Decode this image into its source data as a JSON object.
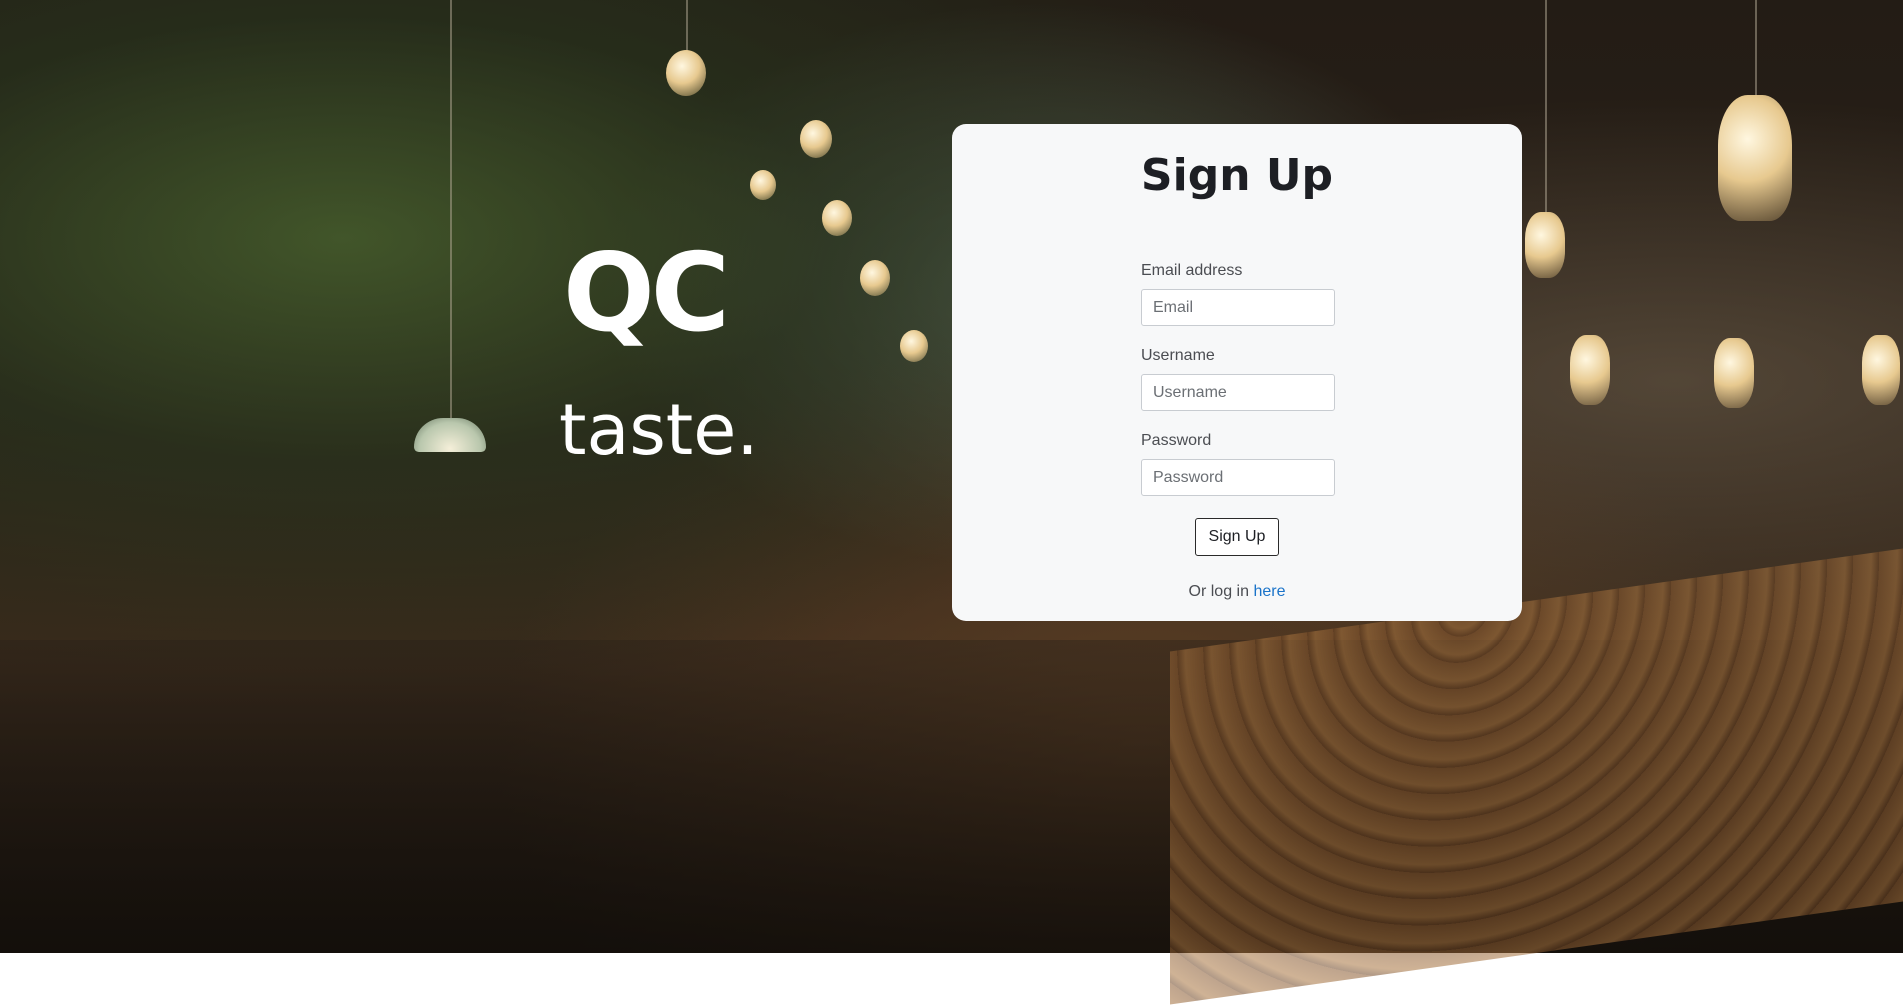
{
  "logo": {
    "mark": "QC",
    "wordmark": "taste."
  },
  "signup": {
    "title": "Sign Up",
    "email": {
      "label": "Email address",
      "placeholder": "Email",
      "value": ""
    },
    "username": {
      "label": "Username",
      "placeholder": "Username",
      "value": ""
    },
    "password": {
      "label": "Password",
      "placeholder": "Password",
      "value": ""
    },
    "submit_label": "Sign Up",
    "login_prefix": "Or log in ",
    "login_link": "here"
  },
  "colors": {
    "card_background": "#f7f8f9",
    "link": "#1a73c9",
    "title_text": "#1d1f24"
  }
}
